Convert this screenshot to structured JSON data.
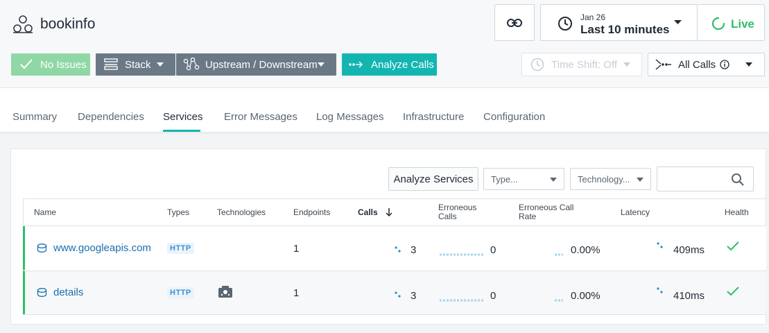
{
  "app": {
    "title": "bookinfo"
  },
  "time": {
    "date": "Jan 26",
    "range": "Last 10 minutes",
    "live_label": "Live"
  },
  "toolbar": {
    "no_issues": "No Issues",
    "stack": "Stack",
    "upstream_downstream": "Upstream / Downstream",
    "analyze_calls": "Analyze Calls",
    "time_shift": "Time Shift: Off",
    "all_calls": "All Calls"
  },
  "tabs": [
    "Summary",
    "Dependencies",
    "Services",
    "Error Messages",
    "Log Messages",
    "Infrastructure",
    "Configuration"
  ],
  "active_tab": "Services",
  "filters": {
    "analyze_services": "Analyze Services",
    "type_placeholder": "Type...",
    "technology_placeholder": "Technology..."
  },
  "table": {
    "headers": {
      "name": "Name",
      "types": "Types",
      "technologies": "Technologies",
      "endpoints": "Endpoints",
      "calls": "Calls",
      "erroneous_calls_1": "Erroneous",
      "erroneous_calls_2": "Calls",
      "erroneous_rate_1": "Erroneous Call",
      "erroneous_rate_2": "Rate",
      "latency": "Latency",
      "health": "Health"
    },
    "rows": [
      {
        "name": "www.googleapis.com",
        "type": "HTTP",
        "endpoints": "1",
        "calls": "3",
        "erroneous_calls": "0",
        "error_rate": "0.00%",
        "latency": "409ms"
      },
      {
        "name": "details",
        "type": "HTTP",
        "endpoints": "1",
        "calls": "3",
        "erroneous_calls": "0",
        "error_rate": "0.00%",
        "latency": "410ms"
      }
    ]
  },
  "colors": {
    "accent": "#13b5b1",
    "healthy": "#2bbf6a",
    "link": "#1a6fb0"
  }
}
